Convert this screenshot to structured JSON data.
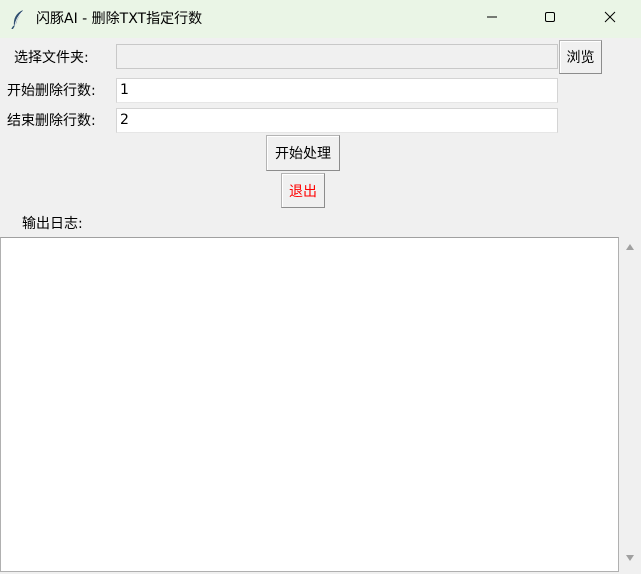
{
  "window": {
    "title": "闪豚AI - 删除TXT指定行数",
    "icon": "feather-icon",
    "controls": {
      "minimize_icon": "minimize-icon",
      "maximize_icon": "maximize-icon",
      "close_icon": "close-icon"
    }
  },
  "form": {
    "folder_label": "选择文件夹:",
    "folder_value": "",
    "browse_label": "浏览",
    "start_line_label": "开始删除行数:",
    "start_line_value": "1",
    "end_line_label": "结束删除行数:",
    "end_line_value": "2"
  },
  "actions": {
    "process_label": "开始处理",
    "exit_label": "退出",
    "exit_color": "#ff0000"
  },
  "log": {
    "label": "输出日志:",
    "content": ""
  },
  "colors": {
    "titlebar_bg": "#eaf5e6",
    "client_bg": "#f0f0f0"
  }
}
